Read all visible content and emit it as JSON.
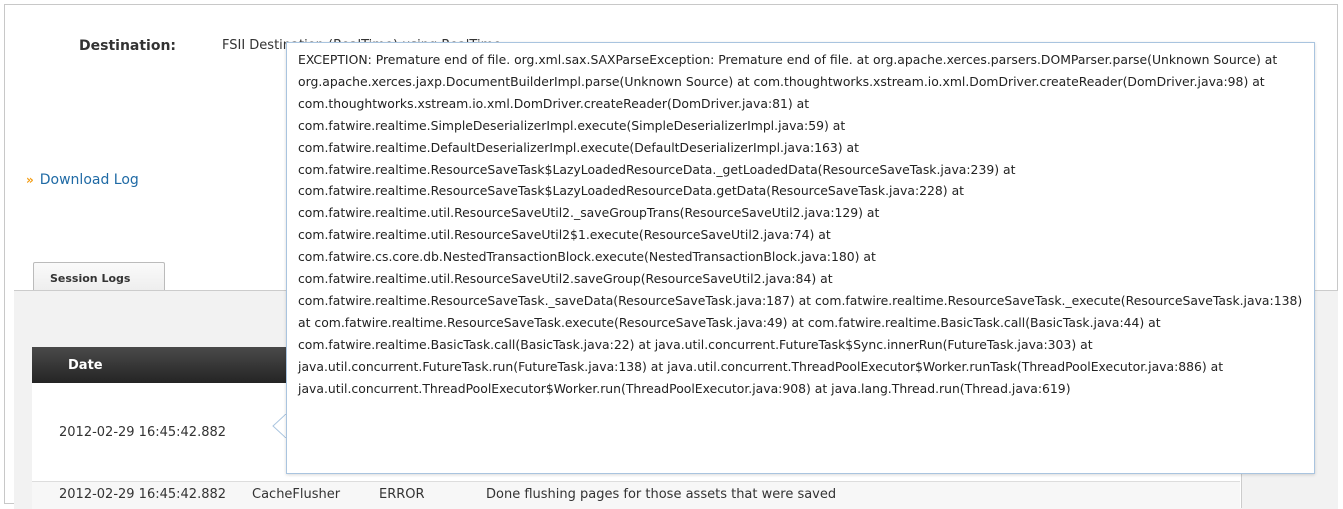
{
  "destination": {
    "label": "Destination:",
    "value": "FSII Destination (RealTime) using RealTime"
  },
  "download_log": {
    "label": "Download Log"
  },
  "tabs": [
    {
      "label": "Session Logs",
      "active": true
    }
  ],
  "table": {
    "headers": {
      "date": "Date"
    },
    "rows": [
      {
        "date": "2012-02-29 16:45:42.882"
      },
      {
        "date": "2012-02-29 16:45:42.882",
        "source": "CacheFlusher",
        "level": "ERROR",
        "message": "Done flushing pages for those assets that were saved"
      }
    ]
  },
  "tooltip": {
    "text": "EXCEPTION: Premature end of file. org.xml.sax.SAXParseException: Premature end of file. at org.apache.xerces.parsers.DOMParser.parse(Unknown Source) at org.apache.xerces.jaxp.DocumentBuilderImpl.parse(Unknown Source) at com.thoughtworks.xstream.io.xml.DomDriver.createReader(DomDriver.java:98) at com.thoughtworks.xstream.io.xml.DomDriver.createReader(DomDriver.java:81) at com.fatwire.realtime.SimpleDeserializerImpl.execute(SimpleDeserializerImpl.java:59) at com.fatwire.realtime.DefaultDeserializerImpl.execute(DefaultDeserializerImpl.java:163) at com.fatwire.realtime.ResourceSaveTask$LazyLoadedResourceData._getLoadedData(ResourceSaveTask.java:239) at com.fatwire.realtime.ResourceSaveTask$LazyLoadedResourceData.getData(ResourceSaveTask.java:228) at com.fatwire.realtime.util.ResourceSaveUtil2._saveGroupTrans(ResourceSaveUtil2.java:129) at com.fatwire.realtime.util.ResourceSaveUtil2$1.execute(ResourceSaveUtil2.java:74) at com.fatwire.cs.core.db.NestedTransactionBlock.execute(NestedTransactionBlock.java:180) at com.fatwire.realtime.util.ResourceSaveUtil2.saveGroup(ResourceSaveUtil2.java:84) at com.fatwire.realtime.ResourceSaveTask._saveData(ResourceSaveTask.java:187) at com.fatwire.realtime.ResourceSaveTask._execute(ResourceSaveTask.java:138) at com.fatwire.realtime.ResourceSaveTask.execute(ResourceSaveTask.java:49) at com.fatwire.realtime.BasicTask.call(BasicTask.java:44) at com.fatwire.realtime.BasicTask.call(BasicTask.java:22) at java.util.concurrent.FutureTask$Sync.innerRun(FutureTask.java:303) at java.util.concurrent.FutureTask.run(FutureTask.java:138) at java.util.concurrent.ThreadPoolExecutor$Worker.runTask(ThreadPoolExecutor.java:886) at java.util.concurrent.ThreadPoolExecutor$Worker.run(ThreadPoolExecutor.java:908) at java.lang.Thread.run(Thread.java:619)"
  },
  "colors": {
    "link": "#1f6aa5",
    "arrow": "#f39c12",
    "header_bg": "#242424",
    "tooltip_border": "#a9c4df"
  }
}
